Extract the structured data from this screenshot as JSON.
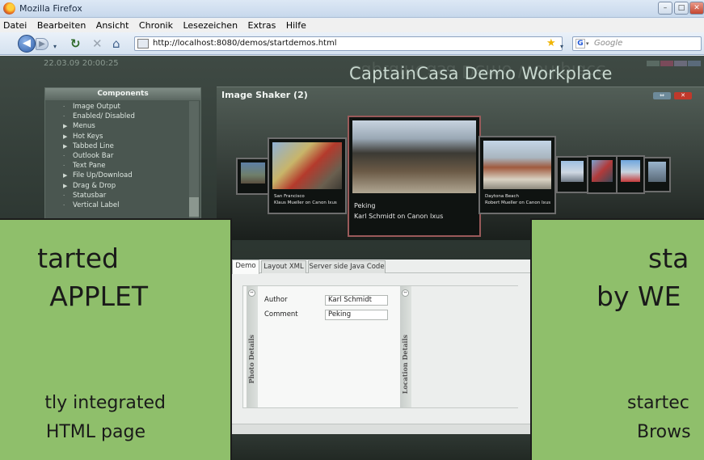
{
  "browser": {
    "window_title": "Mozilla Firefox",
    "menu": [
      "Datei",
      "Bearbeiten",
      "Ansicht",
      "Chronik",
      "Lesezeichen",
      "Extras",
      "Hilfe"
    ],
    "url": "http://localhost:8080/demos/startdemos.html",
    "search_placeholder": "Google",
    "search_engine_letter": "G"
  },
  "app": {
    "datetime": "22.03.09   20:00:25",
    "title": "CaptainCasa Demo Workplace",
    "status_colors": [
      "#5a6a63",
      "#7a4a5a",
      "#6a6a7a",
      "#5a6a7a"
    ]
  },
  "components": {
    "header": "Components",
    "items": [
      {
        "marker": "·",
        "label": "Image Output"
      },
      {
        "marker": "·",
        "label": "Enabled/ Disabled"
      },
      {
        "marker": "▶",
        "label": "Menus"
      },
      {
        "marker": "▶",
        "label": "Hot Keys"
      },
      {
        "marker": "▶",
        "label": "Tabbed Line"
      },
      {
        "marker": "·",
        "label": "Outlook Bar"
      },
      {
        "marker": "·",
        "label": "Text Pane"
      },
      {
        "marker": "▶",
        "label": "File Up/Download"
      },
      {
        "marker": "▶",
        "label": "Drag & Drop"
      },
      {
        "marker": "·",
        "label": "Statusbar"
      },
      {
        "marker": "·",
        "label": "Vertical Label"
      }
    ]
  },
  "shaker": {
    "title": "Image Shaker (2)",
    "thumbs": [
      {
        "title": "San Francisco",
        "author": "Klaus Mueller on Canon Ixus"
      },
      {
        "title": "Peking",
        "author": "Karl Schmidt on Canon Ixus"
      },
      {
        "title": "Daytona Beach",
        "author": "Robert Mueller on Canon Ixus"
      }
    ]
  },
  "tabs": {
    "items": [
      "Demo",
      "Layout XML",
      "Server side Java Code"
    ],
    "active": 0
  },
  "details": {
    "photo_label": "Photo Details",
    "location_label": "Location Details",
    "author_label": "Author",
    "author_value": "Karl Schmidt",
    "comment_label": "Comment",
    "comment_value": "Peking"
  },
  "overlay_left": {
    "line1": "tarted",
    "line2": "APPLET",
    "line3": "tly integrated",
    "line4": "HTML page"
  },
  "overlay_right": {
    "line1": "sta",
    "line2": "by WE",
    "line3": "startec",
    "line4": "Brows"
  }
}
